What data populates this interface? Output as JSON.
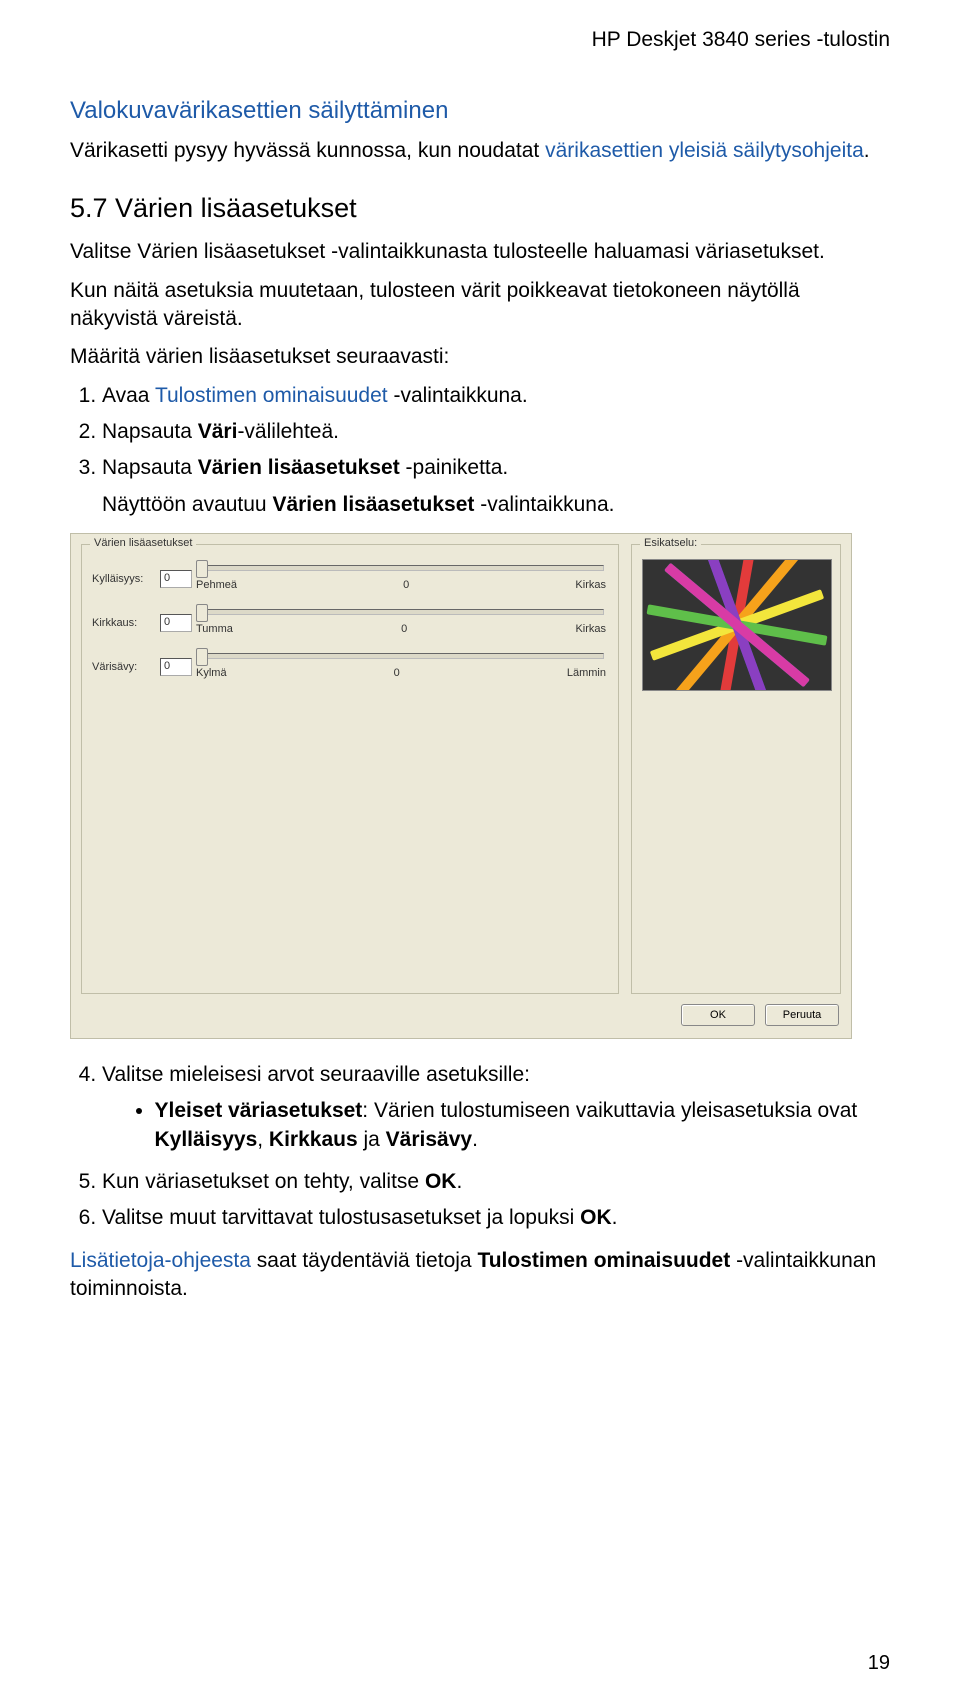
{
  "header": {
    "title": "HP Deskjet 3840 series -tulostin"
  },
  "section_photo": {
    "heading": "Valokuvavärikasettien säilyttäminen",
    "body_prefix": "Värikasetti pysyy hyvässä kunnossa, kun noudatat ",
    "body_link": "värikasettien yleisiä säilytysohjeita",
    "body_suffix": "."
  },
  "section_color": {
    "heading": "5.7 Värien lisäasetukset",
    "intro1": "Valitse Värien lisäasetukset -valintaikkunasta tulosteelle haluamasi väriasetukset.",
    "intro2": "Kun näitä asetuksia muutetaan, tulosteen värit poikkeavat tietokoneen näytöllä näkyvistä väreistä.",
    "intro3": "Määritä värien lisäasetukset seuraavasti:",
    "step1_prefix": "Avaa ",
    "step1_link": "Tulostimen ominaisuudet",
    "step1_suffix": " -valintaikkuna.",
    "step2_prefix": "Napsauta ",
    "step2_bold": "Väri",
    "step2_suffix": "-välilehteä.",
    "step3_prefix": "Napsauta ",
    "step3_bold": "Värien lisäasetukset",
    "step3_suffix": " -painiketta.",
    "step3b_prefix": "Näyttöön avautuu ",
    "step3b_bold": "Värien lisäasetukset",
    "step3b_suffix": " -valintaikkuna.",
    "step4": "Valitse mieleisesi arvot seuraaville asetuksille:",
    "bullet1_bold": "Yleiset väriasetukset",
    "bullet1_mid": ": Värien tulostumiseen vaikuttavia yleisasetuksia ovat ",
    "bullet1_k1": "Kylläisyys",
    "bullet1_sep1": ", ",
    "bullet1_k2": "Kirkkaus",
    "bullet1_sep2": " ja ",
    "bullet1_k3": "Värisävy",
    "bullet1_end": ".",
    "step5_prefix": "Kun väriasetukset on tehty, valitse ",
    "step5_bold": "OK",
    "step5_suffix": ".",
    "step6_prefix": "Valitse muut tarvittavat tulostusasetukset ja lopuksi ",
    "step6_bold": "OK",
    "step6_suffix": ".",
    "footer_link": "Lisätietoja-ohjeesta",
    "footer_mid": " saat täydentäviä tietoja ",
    "footer_bold": "Tulostimen ominaisuudet",
    "footer_end": " -valintaikkunan toiminnoista."
  },
  "dialog": {
    "group_label": "Värien lisäasetukset",
    "preview_label": "Esikatselu:",
    "rows": [
      {
        "label": "Kylläisyys:",
        "value": "0",
        "left": "Pehmeä",
        "mid": "0",
        "right": "Kirkas"
      },
      {
        "label": "Kirkkaus:",
        "value": "0",
        "left": "Tumma",
        "mid": "0",
        "right": "Kirkas"
      },
      {
        "label": "Värisävy:",
        "value": "0",
        "left": "Kylmä",
        "mid": "0",
        "right": "Lämmin"
      }
    ],
    "ok": "OK",
    "cancel": "Peruuta"
  },
  "pagenum": "19"
}
